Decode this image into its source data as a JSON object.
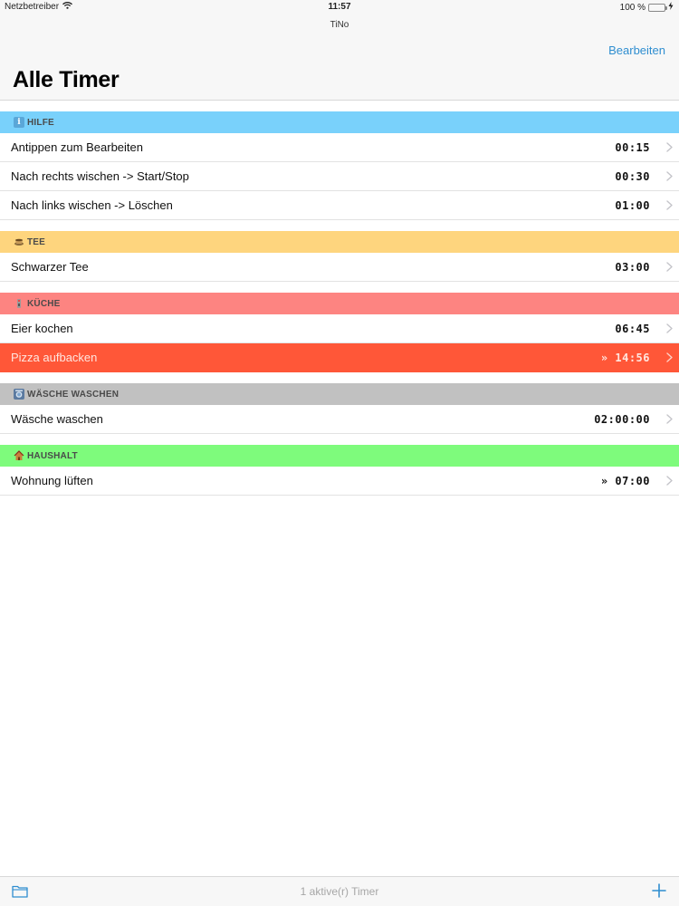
{
  "status_bar": {
    "carrier": "Netzbetreiber",
    "time": "11:57",
    "battery": "100 %",
    "battery_level": 1.0
  },
  "nav": {
    "app_name": "TiNo",
    "edit_label": "Bearbeiten",
    "title": "Alle Timer"
  },
  "sections": [
    {
      "header": "HILFE",
      "icon": "info-icon",
      "color": "#79d1fb",
      "rows": [
        {
          "label": "Antippen zum Bearbeiten",
          "value": "00:15"
        },
        {
          "label": "Nach rechts wischen -> Start/Stop",
          "value": "00:30"
        },
        {
          "label": "Nach links wischen -> Löschen",
          "value": "01:00"
        }
      ]
    },
    {
      "header": "TEE",
      "icon": "tea-icon",
      "color": "#fed57e",
      "rows": [
        {
          "label": "Schwarzer Tee",
          "value": "03:00"
        }
      ]
    },
    {
      "header": "KÜCHE",
      "icon": "kitchen-icon",
      "color": "#fd8481",
      "rows": [
        {
          "label": "Eier kochen",
          "value": "06:45"
        },
        {
          "label": "Pizza aufbacken",
          "value": "» 14:56",
          "active": true,
          "highlight_color": "#ff5738"
        }
      ]
    },
    {
      "header": "WÄSCHE WASCHEN",
      "icon": "laundry-icon",
      "color": "#c1c1c1",
      "rows": [
        {
          "label": "Wäsche waschen",
          "value": "02:00:00"
        }
      ]
    },
    {
      "header": "HAUSHALT",
      "icon": "house-icon",
      "color": "#7efb7c",
      "rows": [
        {
          "label": "Wohnung lüften",
          "value": "» 07:00"
        }
      ]
    }
  ],
  "toolbar": {
    "status": "1 aktive(r) Timer",
    "left_icon": "folder-icon",
    "right_icon": "plus-icon",
    "accent": "#2f8ed0"
  }
}
